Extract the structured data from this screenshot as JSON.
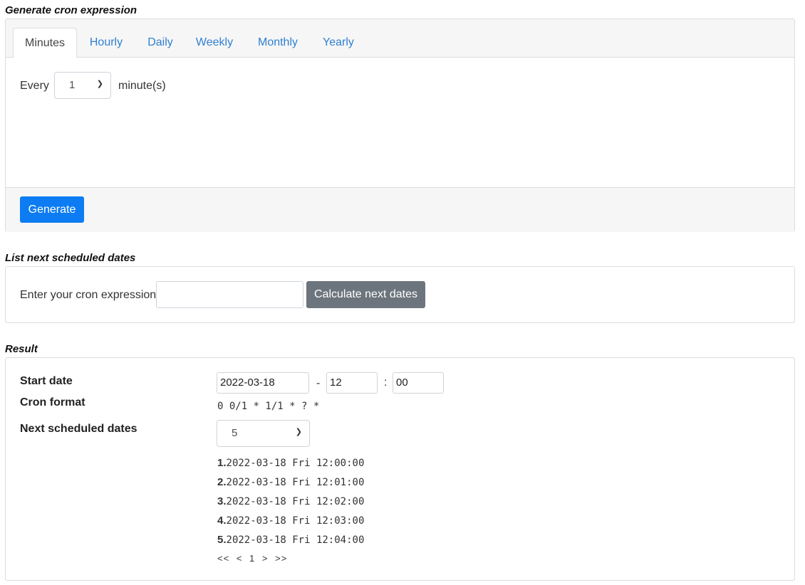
{
  "generate": {
    "title": "Generate cron expression",
    "tabs": [
      "Minutes",
      "Hourly",
      "Daily",
      "Weekly",
      "Monthly",
      "Yearly"
    ],
    "active_tab": "Minutes",
    "every_label": "Every",
    "minute_value": "1",
    "unit_label": "minute(s)",
    "generate_label": "Generate"
  },
  "list": {
    "title": "List next scheduled dates",
    "prompt": "Enter your cron expression",
    "input_value": "",
    "calc_label": "Calculate next dates"
  },
  "result": {
    "title": "Result",
    "start_date_label": "Start date",
    "start_date": "2022-03-18",
    "dash": "-",
    "hour": "12",
    "colon": ":",
    "minute": "00",
    "cron_format_label": "Cron format",
    "cron_format": "0 0/1 * 1/1 * ? *",
    "next_label": "Next scheduled dates",
    "count": "5",
    "dates": [
      {
        "num": "1.",
        "text": "2022-03-18 Fri 12:00:00"
      },
      {
        "num": "2.",
        "text": "2022-03-18 Fri 12:01:00"
      },
      {
        "num": "3.",
        "text": "2022-03-18 Fri 12:02:00"
      },
      {
        "num": "4.",
        "text": "2022-03-18 Fri 12:03:00"
      },
      {
        "num": "5.",
        "text": "2022-03-18 Fri 12:04:00"
      }
    ],
    "pager": {
      "first": "<<",
      "prev": "<",
      "page": "1",
      "next": ">",
      "last": ">>"
    }
  },
  "colors": {
    "primary": "#0d7cf2",
    "secondary": "#6c757d",
    "link": "#2f7fd1"
  },
  "icons": {
    "select_arrow": "chevron-down-icon"
  }
}
